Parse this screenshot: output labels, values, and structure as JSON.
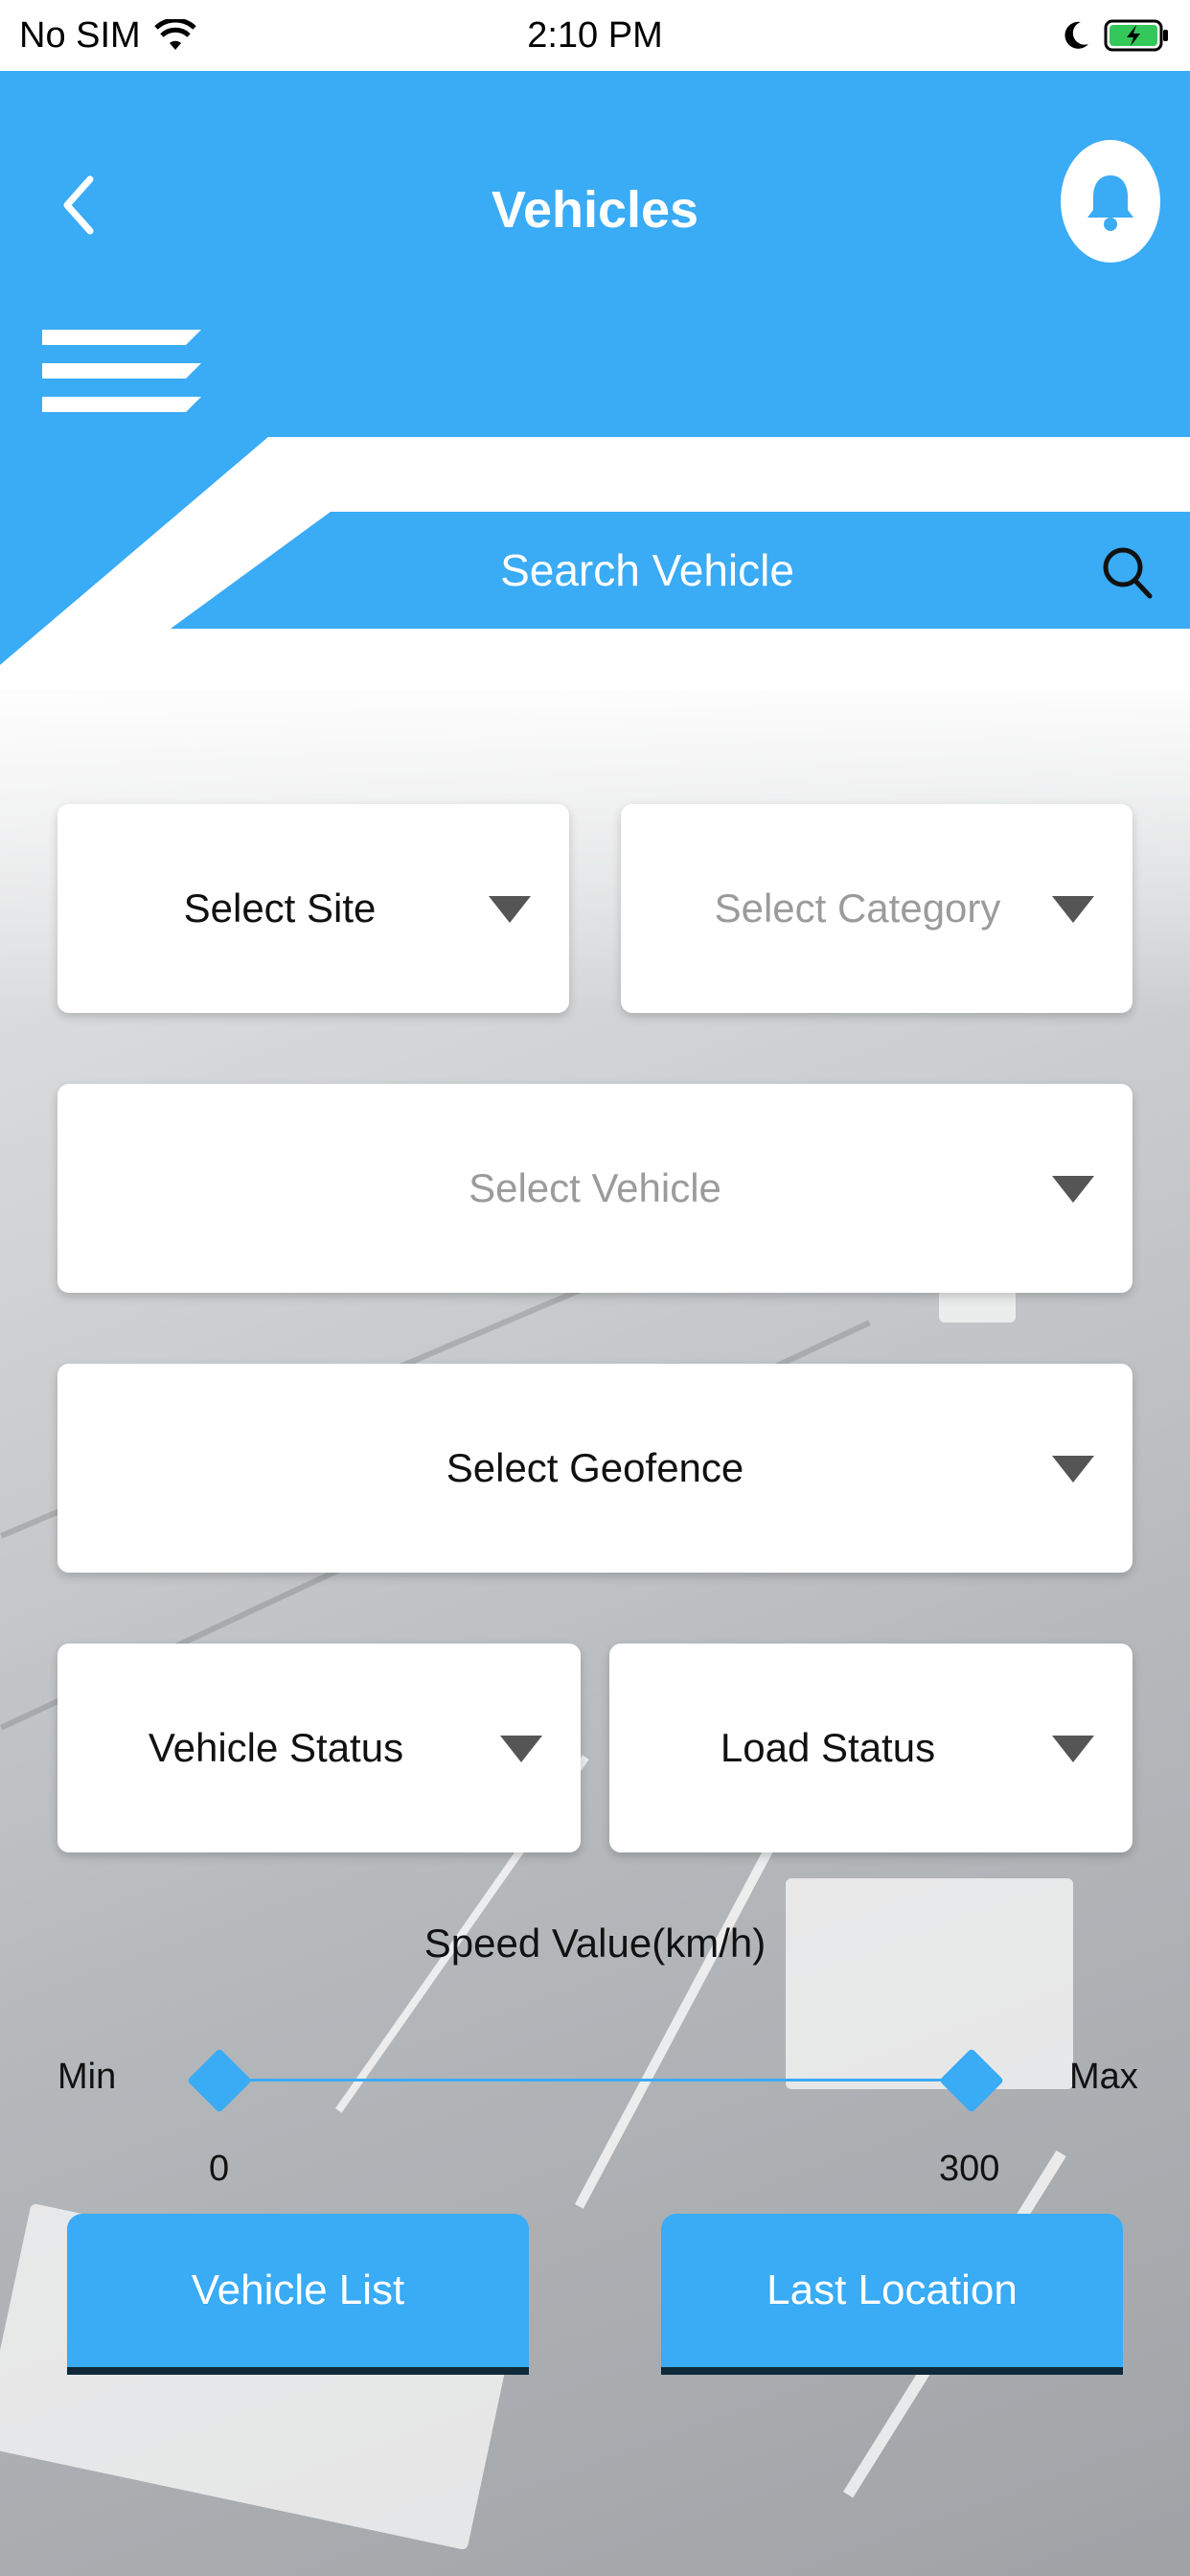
{
  "status_bar": {
    "carrier": "No SIM",
    "time": "2:10 PM"
  },
  "header": {
    "title": "Vehicles"
  },
  "search": {
    "label": "Search Vehicle"
  },
  "filters": {
    "site": "Select Site",
    "category": "Select Category",
    "vehicle": "Select Vehicle",
    "geofence": "Select Geofence",
    "vehicle_status": "Vehicle Status",
    "load_status": "Load Status"
  },
  "speed": {
    "title": "Speed Value(km/h)",
    "min_label": "Min",
    "max_label": "Max",
    "min_value": "0",
    "max_value": "300"
  },
  "actions": {
    "vehicle_list": "Vehicle List",
    "last_location": "Last Location"
  },
  "colors": {
    "accent": "#3aabf5",
    "button_underline": "#0f2a3a"
  },
  "icons": {
    "back": "chevron-left-icon",
    "notifications": "bell-icon",
    "menu": "hamburger-menu-icon",
    "search": "search-icon",
    "dropdown": "caret-down-icon"
  }
}
